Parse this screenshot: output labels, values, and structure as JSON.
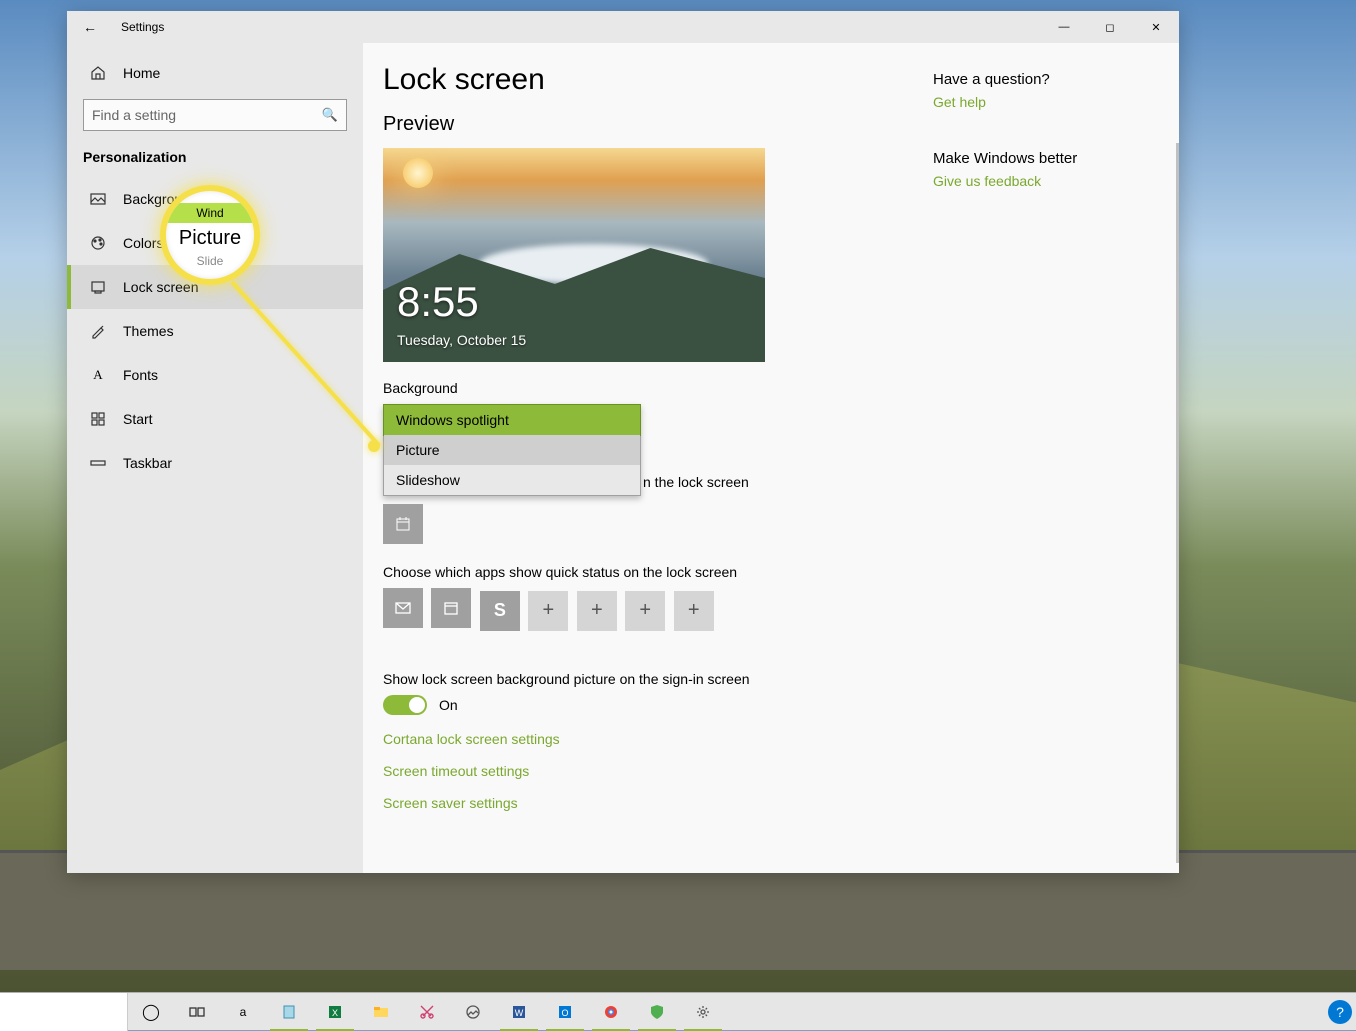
{
  "window": {
    "title": "Settings"
  },
  "sidebar": {
    "home": "Home",
    "search_placeholder": "Find a setting",
    "category": "Personalization",
    "items": [
      {
        "label": "Background"
      },
      {
        "label": "Colors"
      },
      {
        "label": "Lock screen"
      },
      {
        "label": "Themes"
      },
      {
        "label": "Fonts"
      },
      {
        "label": "Start"
      },
      {
        "label": "Taskbar"
      }
    ]
  },
  "page": {
    "title": "Lock screen",
    "preview_heading": "Preview",
    "preview_time": "8:55",
    "preview_date": "Tuesday, October 15",
    "background_label": "Background",
    "background_options": [
      "Windows spotlight",
      "Picture",
      "Slideshow"
    ],
    "detailed_label_tail": "n the lock screen",
    "quick_label": "Choose which apps show quick status on the lock screen",
    "signin_label": "Show lock screen background picture on the sign-in screen",
    "toggle_state": "On",
    "links": [
      "Cortana lock screen settings",
      "Screen timeout settings",
      "Screen saver settings"
    ]
  },
  "right": {
    "q_heading": "Have a question?",
    "q_link": "Get help",
    "fb_heading": "Make Windows better",
    "fb_link": "Give us feedback"
  },
  "callout": {
    "top": "Wind",
    "mid": "Picture",
    "bot": "Slide"
  }
}
